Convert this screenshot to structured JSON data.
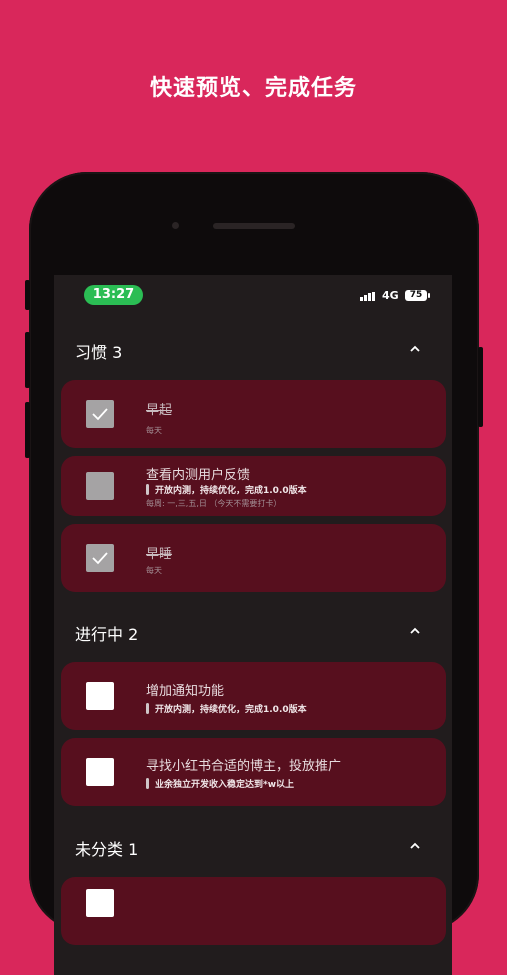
{
  "headline": "快速预览、完成任务",
  "status_bar": {
    "time": "13:27",
    "network": "4G",
    "battery": "75"
  },
  "sections": [
    {
      "title": "习惯 3",
      "tasks": [
        {
          "title": "早起",
          "sub": "每天",
          "note": "",
          "checked": true
        },
        {
          "title": "查看内测用户反馈",
          "note": "开放内测，持续优化，完成1.0.0版本",
          "sub": "每周: 一,三,五,日 （今天不需要打卡）",
          "checked": false
        },
        {
          "title": "早睡",
          "sub": "每天",
          "note": "",
          "checked": true
        }
      ]
    },
    {
      "title": "进行中 2",
      "tasks": [
        {
          "title": "增加通知功能",
          "note": "开放内测，持续优化，完成1.0.0版本",
          "sub": "",
          "checked": false
        },
        {
          "title": "寻找小红书合适的博主，投放推广",
          "note": "业余独立开发收入稳定达到*w以上",
          "sub": "",
          "checked": false
        }
      ]
    },
    {
      "title": "未分类 1",
      "tasks": []
    }
  ],
  "icons": {
    "collapse": "chevron-up-icon",
    "check": "checkmark-icon"
  },
  "colors": {
    "background": "#d9275b",
    "card": "#570f1e",
    "screen": "#211c1d",
    "time_pill": "#2bbd54"
  }
}
